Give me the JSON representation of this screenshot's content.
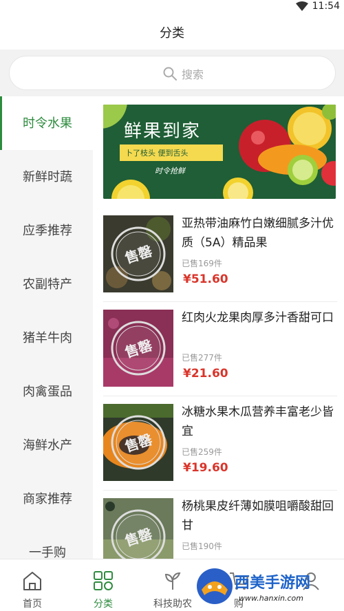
{
  "status": {
    "time": "11:54"
  },
  "header": {
    "title": "分类"
  },
  "search": {
    "placeholder": "搜索"
  },
  "sidebar": {
    "items": [
      {
        "label": "时令水果",
        "active": true
      },
      {
        "label": "新鲜时蔬"
      },
      {
        "label": "应季推荐"
      },
      {
        "label": "农副特产"
      },
      {
        "label": "猪羊牛肉"
      },
      {
        "label": "肉禽蛋品"
      },
      {
        "label": "海鲜水产"
      },
      {
        "label": "商家推荐"
      },
      {
        "label": "一手购"
      }
    ]
  },
  "banner": {
    "title": "鲜果到家",
    "subtitle": "卜了枝头 便到舌头",
    "tag": "时令抢鲜"
  },
  "products": [
    {
      "name": "亚热带油麻竹白嫩细腻多汁优质（5A）精品果",
      "sold": "已售169件",
      "price": "¥51.60",
      "badge": "售罄"
    },
    {
      "name": "红肉火龙果肉厚多汁香甜可口",
      "sold": "已售277件",
      "price": "¥21.60",
      "badge": "售罄"
    },
    {
      "name": "冰糖水果木瓜营养丰富老少皆宜",
      "sold": "已售259件",
      "price": "¥19.60",
      "badge": "售罄"
    },
    {
      "name": "杨桃果皮纤薄如膜咀嚼酸甜回甘",
      "sold": "已售190件",
      "price": "",
      "badge": "售罄"
    }
  ],
  "tabbar": {
    "items": [
      {
        "label": "首页",
        "icon": "home-icon"
      },
      {
        "label": "分类",
        "icon": "grid-icon",
        "active": true
      },
      {
        "label": "科技助农",
        "icon": "sprout-icon"
      },
      {
        "label": "购",
        "icon": "cart-icon"
      },
      {
        "label": "",
        "icon": "user-icon"
      }
    ]
  },
  "watermark": {
    "text": "西美手游网",
    "url": "www.hanxin.com"
  },
  "colors": {
    "accent": "#2e8b3e",
    "price": "#d9352b"
  }
}
